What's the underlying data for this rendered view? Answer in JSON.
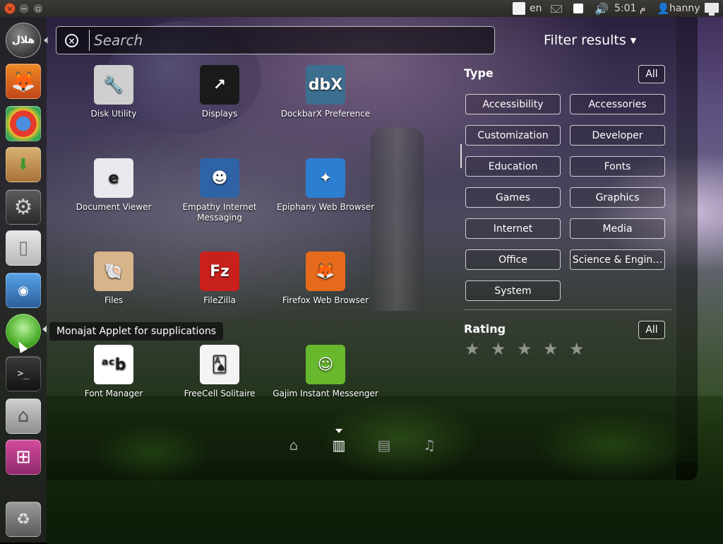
{
  "top_panel": {
    "language": "en",
    "clock": "5:01 م",
    "username": "hanny"
  },
  "launcher": {
    "items": [
      {
        "name": "Firefox"
      },
      {
        "name": "Chromium"
      },
      {
        "name": "Software Center"
      },
      {
        "name": "System Settings"
      },
      {
        "name": "LibreOffice"
      },
      {
        "name": "eclipse"
      },
      {
        "name": "Monajat Applet"
      },
      {
        "name": "Terminal"
      },
      {
        "name": "Home Folder"
      },
      {
        "name": "Workspace Switcher"
      },
      {
        "name": "Trash"
      }
    ],
    "bfb_label": "هلال"
  },
  "search": {
    "placeholder": "Search"
  },
  "filter": {
    "label": "Filter results",
    "type_title": "Type",
    "type_all": "All",
    "categories": [
      "Accessibility",
      "Accessories",
      "Customization",
      "Developer",
      "Education",
      "Fonts",
      "Games",
      "Graphics",
      "Internet",
      "Media",
      "Office",
      "Science & Engin…",
      "System"
    ],
    "rating_title": "Rating",
    "rating_all": "All",
    "rating_stars": 5
  },
  "apps": [
    {
      "label": "Disk Utility",
      "icon": "disk-utility-icon",
      "glyph": "🔧",
      "color": "#cfcfcf"
    },
    {
      "label": "Displays",
      "icon": "displays-icon",
      "glyph": "↗",
      "color": "#1a1a1a"
    },
    {
      "label": "DockbarX Preference",
      "icon": "dockbarx-icon",
      "glyph": "dbX",
      "color": "#3c6e8f"
    },
    {
      "label": "Document Viewer",
      "icon": "document-viewer-icon",
      "glyph": "e",
      "color": "#e8e8ee"
    },
    {
      "label": "Empathy Internet Messaging",
      "icon": "empathy-icon",
      "glyph": "☻",
      "color": "#2e63a6"
    },
    {
      "label": "Epiphany Web Browser",
      "icon": "epiphany-icon",
      "glyph": "✦",
      "color": "#2c7fd0"
    },
    {
      "label": "Files",
      "icon": "files-icon",
      "glyph": "🐚",
      "color": "#d8b48a"
    },
    {
      "label": "FileZilla",
      "icon": "filezilla-icon",
      "glyph": "Fz",
      "color": "#c8201c"
    },
    {
      "label": "Firefox Web Browser",
      "icon": "firefox-icon",
      "glyph": "🦊",
      "color": "#e66a1b"
    },
    {
      "label": "Font Manager",
      "icon": "font-manager-icon",
      "glyph": "ᵃᶜb",
      "color": "#ffffff"
    },
    {
      "label": "FreeCell Solitaire",
      "icon": "freecell-icon",
      "glyph": "🂡",
      "color": "#f4f4f4"
    },
    {
      "label": "Gajim Instant Messenger",
      "icon": "gajim-icon",
      "glyph": "☺",
      "color": "#67b82c"
    }
  ],
  "tooltip": {
    "text": "Monajat Applet for supplications"
  },
  "lenses": [
    {
      "name": "home-lens-icon",
      "glyph": "⌂"
    },
    {
      "name": "applications-lens-icon",
      "glyph": "▥"
    },
    {
      "name": "files-lens-icon",
      "glyph": "▤"
    },
    {
      "name": "music-lens-icon",
      "glyph": "♫"
    }
  ],
  "colors": {
    "accent_orange": "#e0572c",
    "panel_bg": "#3c3b37"
  }
}
